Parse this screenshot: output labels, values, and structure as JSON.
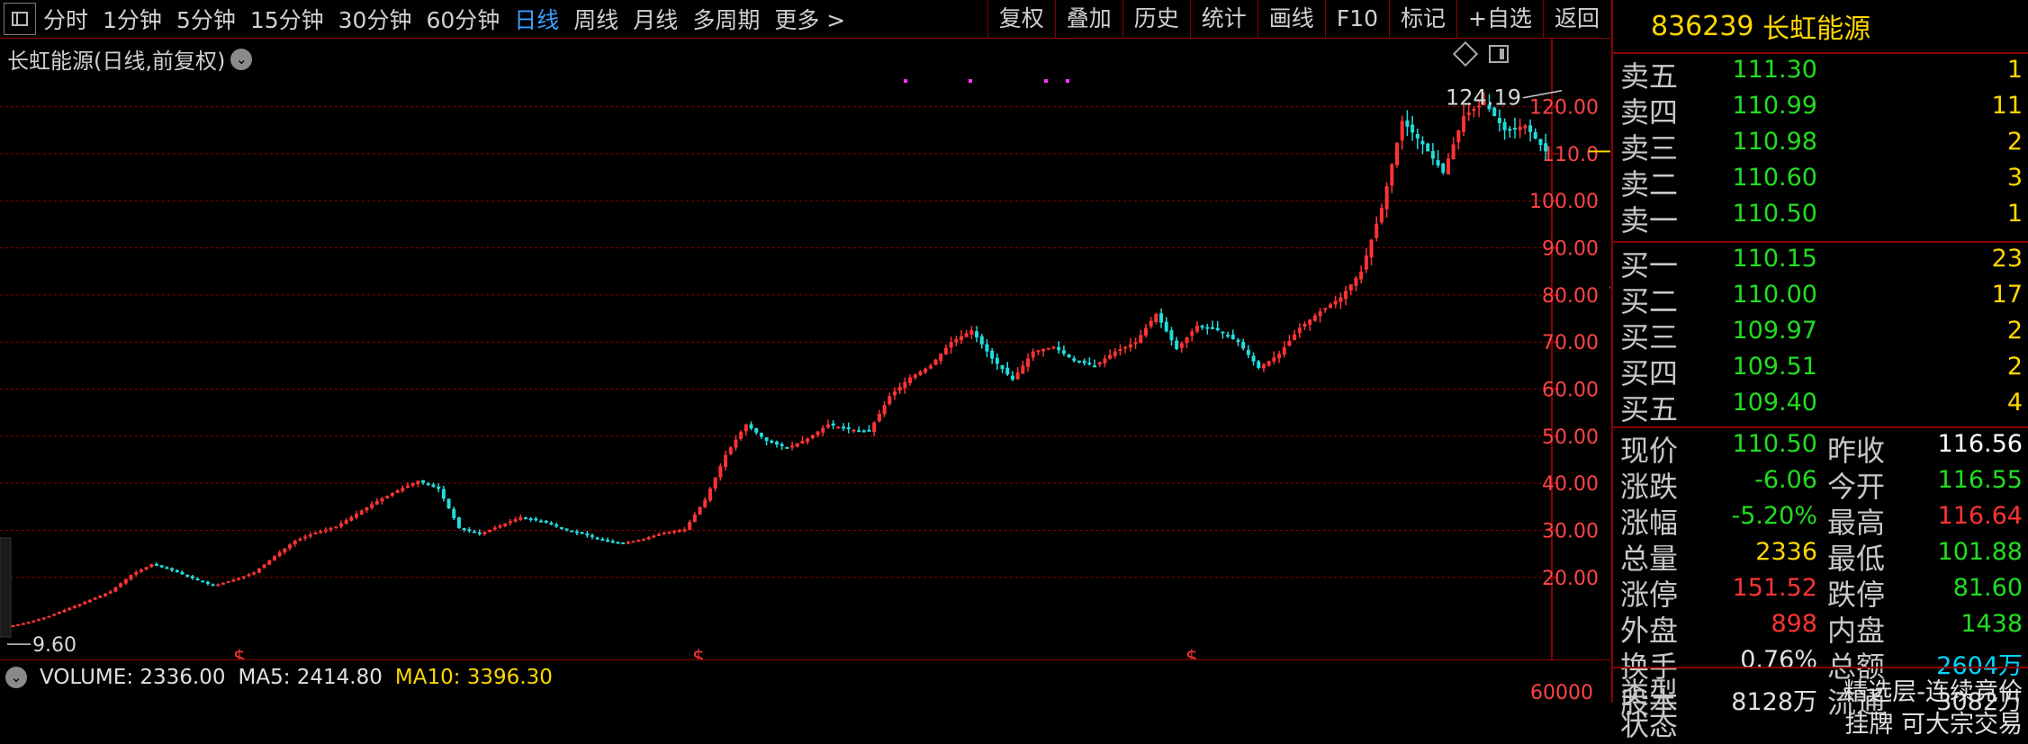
{
  "toolbar": {
    "periods": [
      "分时",
      "1分钟",
      "5分钟",
      "15分钟",
      "30分钟",
      "60分钟",
      "日线",
      "周线",
      "月线",
      "多周期",
      "更多 >"
    ],
    "active_period": "日线",
    "right_buttons": [
      "复权",
      "叠加",
      "历史",
      "统计",
      "画线",
      "F10",
      "标记",
      "+自选",
      "返回"
    ]
  },
  "chart": {
    "title": "长虹能源(日线,前复权)",
    "high_label": "124.19",
    "low_label": "9.60",
    "y_ticks": [
      "120.00",
      "110.0",
      "100.00",
      "90.00",
      "80.00",
      "70.00",
      "60.00",
      "50.00",
      "40.00",
      "30.00",
      "20.00"
    ],
    "dividend_marker": "$",
    "volume_axis_label": "60000"
  },
  "chart_data": {
    "type": "candlestick",
    "title": "长虹能源(日线,前复权)",
    "y_ticks": [
      20,
      30,
      40,
      50,
      60,
      70,
      80,
      90,
      100,
      110,
      120
    ],
    "ylim": [
      6,
      127
    ],
    "max_marked": 124.19,
    "min_marked": 9.6,
    "series": [
      {
        "name": "close",
        "values": [
          9.6,
          10.5,
          11.8,
          13.5,
          15.2,
          17.0,
          20.5,
          22.8,
          21.5,
          19.8,
          18.2,
          19.5,
          21.0,
          24.5,
          27.8,
          29.5,
          30.8,
          33.5,
          36.2,
          38.5,
          40.5,
          38.8,
          30.5,
          29.2,
          31.0,
          32.8,
          32.0,
          30.4,
          29.2,
          28.0,
          27.3,
          28.2,
          29.5,
          30.2,
          36.5,
          46.0,
          52.5,
          49.0,
          47.5,
          49.5,
          52.5,
          51.5,
          51.0,
          58.5,
          62.5,
          65.0,
          70.0,
          72.5,
          66.5,
          62.0,
          68.0,
          69.0,
          66.0,
          65.0,
          68.0,
          70.0,
          76.0,
          68.5,
          73.5,
          72.5,
          70.0,
          64.5,
          67.5,
          73.0,
          76.5,
          79.5,
          85.0,
          98.5,
          117.0,
          112.0,
          106.0,
          118.0,
          121.0,
          115.0,
          116.0,
          110.5
        ]
      }
    ]
  },
  "volume": {
    "title": "VOLUME: 2336.00",
    "ma5": "MA5: 2414.80",
    "ma10": "MA10: 3396.30"
  },
  "quote": {
    "code": "836239",
    "name": "长虹能源",
    "asks": [
      {
        "label": "卖五",
        "price": "111.30",
        "vol": "1"
      },
      {
        "label": "卖四",
        "price": "110.99",
        "vol": "11"
      },
      {
        "label": "卖三",
        "price": "110.98",
        "vol": "2"
      },
      {
        "label": "卖二",
        "price": "110.60",
        "vol": "3"
      },
      {
        "label": "卖一",
        "price": "110.50",
        "vol": "1"
      }
    ],
    "bids": [
      {
        "label": "买一",
        "price": "110.15",
        "vol": "23"
      },
      {
        "label": "买二",
        "price": "110.00",
        "vol": "17"
      },
      {
        "label": "买三",
        "price": "109.97",
        "vol": "2"
      },
      {
        "label": "买四",
        "price": "109.51",
        "vol": "2"
      },
      {
        "label": "买五",
        "price": "109.40",
        "vol": "4"
      }
    ],
    "stats": [
      {
        "l1": "现价",
        "v1": "110.50",
        "c1": "#22dd22",
        "l2": "昨收",
        "v2": "116.56",
        "c2": "#ffffff"
      },
      {
        "l1": "涨跌",
        "v1": "-6.06",
        "c1": "#22dd22",
        "l2": "今开",
        "v2": "116.55",
        "c2": "#22dd22"
      },
      {
        "l1": "涨幅",
        "v1": "-5.20%",
        "c1": "#22dd22",
        "l2": "最高",
        "v2": "116.64",
        "c2": "#ff3333"
      },
      {
        "l1": "总量",
        "v1": "2336",
        "c1": "#ffd700",
        "l2": "最低",
        "v2": "101.88",
        "c2": "#22dd22"
      },
      {
        "l1": "涨停",
        "v1": "151.52",
        "c1": "#ff3333",
        "l2": "跌停",
        "v2": "81.60",
        "c2": "#22dd22"
      },
      {
        "l1": "外盘",
        "v1": "898",
        "c1": "#ff3333",
        "l2": "内盘",
        "v2": "1438",
        "c2": "#22dd22"
      },
      {
        "l1": "换手",
        "v1": "0.76%",
        "c1": "#e0e0e0",
        "l2": "总额",
        "v2": "2604万",
        "c2": "#00d8ff"
      },
      {
        "l1": "股本",
        "v1": "8128万",
        "c1": "#e0e0e0",
        "l2": "流通",
        "v2": "3082万",
        "c2": "#e0e0e0"
      }
    ],
    "type_label": "类型",
    "type_value": "精选层-连续竞价",
    "status_label": "状态",
    "status_value": "挂牌  可大宗交易"
  },
  "colors": {
    "up": "#ff3333",
    "down": "#22dddd",
    "grid": "#8a0000",
    "accent": "#3aa0ff",
    "gold": "#ffd700"
  }
}
